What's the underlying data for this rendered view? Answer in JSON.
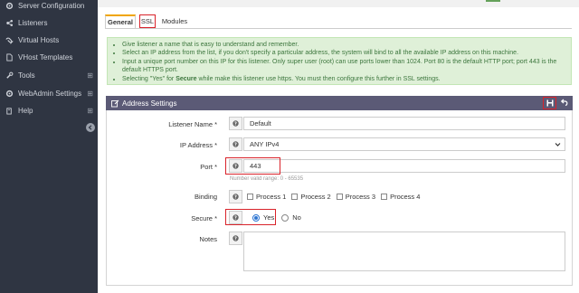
{
  "sidebar": {
    "items": [
      {
        "label": "Server Configuration",
        "icon": "gear-icon",
        "has_plus": false
      },
      {
        "label": "Listeners",
        "icon": "listeners-icon",
        "has_plus": false
      },
      {
        "label": "Virtual Hosts",
        "icon": "virtual-hosts-icon",
        "has_plus": false
      },
      {
        "label": "VHost Templates",
        "icon": "file-icon",
        "has_plus": false
      },
      {
        "label": "Tools",
        "icon": "tools-icon",
        "has_plus": true
      },
      {
        "label": "WebAdmin Settings",
        "icon": "gear-icon",
        "has_plus": true
      },
      {
        "label": "Help",
        "icon": "book-icon",
        "has_plus": true
      }
    ],
    "plus_symbol": "⊞"
  },
  "tabs": [
    {
      "label": "General",
      "active": true
    },
    {
      "label": "SSL",
      "active": false
    },
    {
      "label": "Modules",
      "active": false
    }
  ],
  "info": [
    "Give listener a name that is easy to understand and remember.",
    "Select an IP address from the list, if you don't specify a particular address, the system will bind to all the available IP address on this machine.",
    "Input a unique port number on this IP for this listener. Only super user (root) can use ports lower than 1024. Port 80 is the default HTTP port; port 443 is the default HTTPS port.",
    "Selecting \"Yes\" for Secure while make this listener use https. You must then configure this further in SSL settings."
  ],
  "panel": {
    "title": "Address Settings"
  },
  "form": {
    "listener_name_label": "Listener Name *",
    "listener_name_value": "Default",
    "ip_label": "IP Address *",
    "ip_value": "ANY IPv4",
    "port_label": "Port *",
    "port_value": "443",
    "port_hint": "Number valid range: 0 - 65535",
    "binding_label": "Binding",
    "binding_options": [
      "Process 1",
      "Process 2",
      "Process 3",
      "Process 4"
    ],
    "secure_label": "Secure *",
    "secure_yes": "Yes",
    "secure_no": "No",
    "secure_value": "Yes",
    "notes_label": "Notes"
  },
  "colors": {
    "sidebar_bg": "#2f3542",
    "panel_header_bg": "#5b5a76",
    "info_bg": "#dff0d8",
    "info_text": "#3c763d",
    "highlight": "#d9232a",
    "tab_accent": "#f0a500"
  }
}
